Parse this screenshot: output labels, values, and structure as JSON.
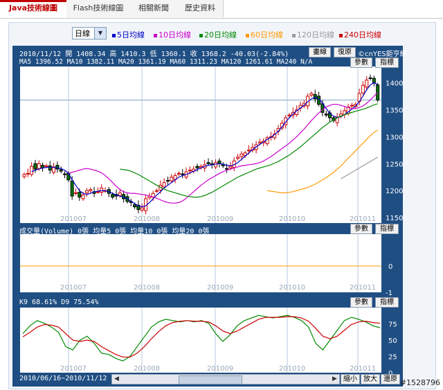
{
  "tabs": [
    {
      "label": "Java技術線圖",
      "active": true
    },
    {
      "label": "Flash技術線圖",
      "active": false
    },
    {
      "label": "相關新聞",
      "active": false
    },
    {
      "label": "歷史資料",
      "active": false
    }
  ],
  "period_select": {
    "value": "日線"
  },
  "ma_legend": [
    {
      "label": "5日均線",
      "color": "#0000cc"
    },
    {
      "label": "10日均線",
      "color": "#cc00cc"
    },
    {
      "label": "20日均線",
      "color": "#008800"
    },
    {
      "label": "60日均線",
      "color": "#ff9900"
    },
    {
      "label": "120日均線",
      "color": "#999999"
    },
    {
      "label": "240日均線",
      "color": "#cc0000"
    }
  ],
  "price_panel": {
    "info_line": "2010/11/12 開 1408.34 高 1410.3 低 1360.1 收 1368.2 -40.03(-2.84%)",
    "ma_line": "MA5 1396.52  MA10 1382.11  MA20 1361.19  MA60 1311.23  MA120 1261.61  MA240 N/A",
    "buttons": [
      "畫線",
      "復原"
    ],
    "brand": "©cnYES鉅亨網",
    "params_label": "參數",
    "indicator_label": "指標"
  },
  "volume_panel": {
    "header": "成交量(Volume) 0張   均量5 0張   均量10 0張   均量20 0張",
    "params_label": "參數",
    "indicator_label": "指標"
  },
  "kd_panel": {
    "header": "K9 68.61%  D9 75.54%",
    "params_label": "參數",
    "indicator_label": "指標"
  },
  "footer": {
    "date_range": "2010/06/16~2010/11/12",
    "zoom_out": "縮小",
    "zoom_in": "放大",
    "reset": "還原"
  },
  "watermark": "#1528796",
  "chart_data": [
    {
      "type": "candlestick",
      "title": "",
      "x_ticks": [
        "201007",
        "201008",
        "201009",
        "201010",
        "201011"
      ],
      "y_ticks": [
        1150,
        1200,
        1250,
        1300,
        1350,
        1400
      ],
      "ylim": [
        1140,
        1430
      ],
      "close": [
        1230,
        1232,
        1245,
        1240,
        1250,
        1242,
        1246,
        1238,
        1244,
        1240,
        1236,
        1230,
        1220,
        1190,
        1196,
        1188,
        1192,
        1200,
        1202,
        1195,
        1198,
        1205,
        1200,
        1195,
        1188,
        1190,
        1196,
        1185,
        1180,
        1178,
        1170,
        1165,
        1168,
        1185,
        1190,
        1195,
        1200,
        1210,
        1215,
        1218,
        1225,
        1228,
        1232,
        1230,
        1235,
        1238,
        1240,
        1242,
        1245,
        1248,
        1250,
        1248,
        1252,
        1250,
        1246,
        1240,
        1245,
        1255,
        1262,
        1268,
        1270,
        1275,
        1280,
        1285,
        1290,
        1292,
        1298,
        1300,
        1305,
        1315,
        1325,
        1335,
        1340,
        1345,
        1350,
        1358,
        1362,
        1375,
        1380,
        1370,
        1360,
        1345,
        1340,
        1335,
        1330,
        1335,
        1342,
        1348,
        1355,
        1358,
        1360,
        1380,
        1395,
        1405,
        1408,
        1400,
        1368
      ],
      "ma": [
        {
          "name": "MA5",
          "color": "#0000cc",
          "values": [
            1235,
            1238,
            1240,
            1242,
            1243,
            1244,
            1243,
            1242,
            1241,
            1238,
            1232,
            1220,
            1210,
            1200,
            1195,
            1193,
            1195,
            1198,
            1199,
            1200,
            1200,
            1198,
            1195,
            1192,
            1190,
            1188,
            1185,
            1180,
            1176,
            1172,
            1170,
            1172,
            1178,
            1185,
            1192,
            1198,
            1205,
            1210,
            1215,
            1220,
            1225,
            1228,
            1230,
            1233,
            1236,
            1239,
            1242,
            1245,
            1247,
            1248,
            1249,
            1250,
            1249,
            1247,
            1246,
            1248,
            1252,
            1258,
            1264,
            1270,
            1276,
            1281,
            1286,
            1290,
            1295,
            1299,
            1304,
            1310,
            1318,
            1327,
            1335,
            1342,
            1348,
            1353,
            1358,
            1365,
            1370,
            1373,
            1370,
            1362,
            1352,
            1343,
            1338,
            1336,
            1337,
            1341,
            1346,
            1351,
            1357,
            1365,
            1375,
            1387,
            1396,
            1400,
            1396
          ]
        },
        {
          "name": "MA10",
          "color": "#cc00cc",
          "values": [
            1232,
            1234,
            1236,
            1238,
            1240,
            1241,
            1240,
            1238,
            1236,
            1233,
            1228,
            1222,
            1215,
            1208,
            1202,
            1198,
            1196,
            1195,
            1195,
            1194,
            1193,
            1192,
            1190,
            1188,
            1186,
            1183,
            1180,
            1178,
            1177,
            1177,
            1178,
            1181,
            1186,
            1192,
            1198,
            1204,
            1210,
            1215,
            1220,
            1224,
            1228,
            1232,
            1235,
            1238,
            1240,
            1242,
            1244,
            1246,
            1247,
            1248,
            1249,
            1250,
            1252,
            1255,
            1259,
            1263,
            1268,
            1273,
            1278,
            1283,
            1288,
            1294,
            1300,
            1307,
            1314,
            1322,
            1330,
            1337,
            1344,
            1350,
            1355,
            1358,
            1360,
            1360,
            1358,
            1356,
            1354,
            1352,
            1352,
            1354,
            1357,
            1362,
            1368,
            1375,
            1382
          ]
        },
        {
          "name": "MA20",
          "color": "#008800",
          "values": [
            1240,
            1239,
            1238,
            1236,
            1233,
            1230,
            1226,
            1222,
            1218,
            1214,
            1210,
            1206,
            1203,
            1200,
            1198,
            1196,
            1194,
            1192,
            1190,
            1189,
            1188,
            1188,
            1189,
            1191,
            1194,
            1197,
            1201,
            1205,
            1209,
            1213,
            1217,
            1221,
            1225,
            1228,
            1231,
            1234,
            1237,
            1240,
            1242,
            1244,
            1246,
            1248,
            1251,
            1254,
            1258,
            1262,
            1266,
            1271,
            1276,
            1281,
            1287,
            1293,
            1299,
            1305,
            1311,
            1317,
            1322,
            1327,
            1331,
            1335,
            1338,
            1341,
            1343,
            1345,
            1347,
            1349,
            1351,
            1353,
            1356,
            1359,
            1361
          ]
        },
        {
          "name": "MA60",
          "color": "#ff9900",
          "values": [
            1200,
            1199,
            1198,
            1197,
            1196,
            1196,
            1197,
            1198,
            1200,
            1202,
            1204,
            1206,
            1209,
            1212,
            1216,
            1220,
            1224,
            1229,
            1234,
            1240,
            1246,
            1253,
            1260,
            1267,
            1274,
            1281,
            1288,
            1295,
            1302,
            1308,
            1312
          ]
        },
        {
          "name": "MA120",
          "color": "#999999",
          "values": [
            1222,
            1226,
            1230,
            1234,
            1238,
            1242,
            1246,
            1250,
            1254,
            1258,
            1262
          ]
        }
      ]
    },
    {
      "type": "line",
      "title": "",
      "y_ticks": [
        0,
        -1
      ],
      "series": [
        {
          "name": "均量",
          "color": "#ff9900",
          "values": [
            0,
            0,
            0,
            0,
            0,
            0,
            0,
            0,
            0,
            0
          ]
        }
      ]
    },
    {
      "type": "line",
      "title": "",
      "y_ticks": [
        75,
        50,
        25,
        0
      ],
      "ylim": [
        0,
        100
      ],
      "series": [
        {
          "name": "K9",
          "color": "#008800",
          "values": [
            60,
            72,
            80,
            76,
            70,
            62,
            40,
            35,
            50,
            56,
            45,
            30,
            28,
            22,
            18,
            25,
            40,
            55,
            70,
            78,
            82,
            80,
            78,
            80,
            78,
            80,
            76,
            60,
            48,
            58,
            72,
            80,
            84,
            88,
            86,
            84,
            86,
            88,
            85,
            80,
            70,
            45,
            35,
            50,
            65,
            80,
            85,
            82,
            78,
            72,
            69
          ]
        },
        {
          "name": "D9",
          "color": "#cc0000",
          "values": [
            55,
            62,
            70,
            74,
            73,
            70,
            60,
            50,
            48,
            50,
            48,
            40,
            34,
            28,
            24,
            24,
            30,
            40,
            52,
            63,
            72,
            77,
            79,
            80,
            79,
            79,
            78,
            72,
            64,
            60,
            64,
            70,
            76,
            82,
            85,
            85,
            85,
            86,
            86,
            84,
            79,
            68,
            56,
            52,
            56,
            65,
            74,
            78,
            79,
            77,
            76
          ]
        }
      ]
    }
  ]
}
